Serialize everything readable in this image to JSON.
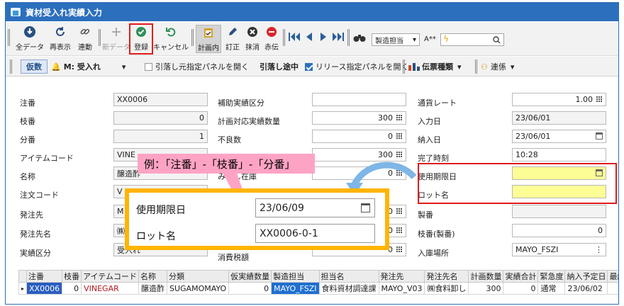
{
  "window": {
    "title": "資材受入れ実績入力"
  },
  "toolbar": {
    "all_data": "全データ",
    "redisplay": "再表示",
    "link": "連動",
    "new_data": "新データ",
    "register": "登録",
    "cancel": "キャンセル",
    "in_plan": "計画内",
    "correct": "訂正",
    "delete": "抹消",
    "red_slip": "赤伝",
    "field_select": "製造担当",
    "font_label": "A**"
  },
  "toolbar2": {
    "kari": "仮数",
    "mode": "M: 受入れ",
    "deduct_panel": "引落し元指定パネルを開く",
    "deduct_status": "引落し途中",
    "release_panel": "リリース指定パネルを開く",
    "slip_type": "伝票種類",
    "link": "連係"
  },
  "form": {
    "col1": [
      {
        "label": "注番",
        "value": "XX0006"
      },
      {
        "label": "枝番",
        "value": "0"
      },
      {
        "label": "分番",
        "value": "1"
      },
      {
        "label": "アイテムコード",
        "value": "VINE"
      },
      {
        "label": "名称",
        "value": "醸造酢"
      },
      {
        "label": "注文コード",
        "value": "V"
      },
      {
        "label": "発注先",
        "value": "M"
      },
      {
        "label": "発注先名",
        "value": "㈱"
      },
      {
        "label": "実績区分",
        "value": "受入れ"
      }
    ],
    "col2": [
      {
        "label": "補助実績区分",
        "value": ""
      },
      {
        "label": "計画対応実績数量",
        "value": "300"
      },
      {
        "label": "不良数",
        "value": "0"
      },
      {
        "label": "",
        "value": "300"
      },
      {
        "label": "みなし在庫",
        "value": "0"
      },
      {
        "label": "",
        "value": "0.0"
      },
      {
        "label": "",
        "value": "0.0"
      },
      {
        "label": "",
        "value": "0"
      },
      {
        "label": "消費税額",
        "value": ""
      }
    ],
    "col3": [
      {
        "label": "通貨レート",
        "value": "1.00"
      },
      {
        "label": "入力日",
        "value": "23/06/01"
      },
      {
        "label": "納入日",
        "value": "23/06/01"
      },
      {
        "label": "完了時刻",
        "value": "10:28"
      },
      {
        "label": "使用期限日",
        "value": ""
      },
      {
        "label": "ロット名",
        "value": ""
      },
      {
        "label": "製番",
        "value": ""
      },
      {
        "label": "枝番(製番)",
        "value": "0"
      },
      {
        "label": "入庫場所",
        "value": "MAYO_FSZI"
      }
    ]
  },
  "callout": {
    "text": "例：「注番」-「枝番」-「分番」"
  },
  "zoom": {
    "expiry_label": "使用期限日",
    "expiry_value": "23/06/09",
    "lot_label": "ロット名",
    "lot_value": "XX0006-0-1"
  },
  "grid": {
    "headers": [
      "注番",
      "枝番",
      "アイテムコード",
      "名称",
      "分類",
      "仮実績数量",
      "製造担当",
      "担当名",
      "発注先",
      "発注先名",
      "計画数量",
      "実績合計",
      "緊急度",
      "納入予定日",
      "最終"
    ],
    "row": [
      "XX0006",
      "0",
      "VINEGAR",
      "醸造酢",
      "SUGAMOMAYO",
      "0",
      "MAYO_FSZI",
      "食料資材調達課",
      "MAYO_V03",
      "㈱食料卸し",
      "300",
      "0",
      "通常",
      "23/06/02",
      ""
    ]
  },
  "colors": {
    "titlebar": "#2c6fbd",
    "highlight": "#fdfd96",
    "callout": "#ffa3c5",
    "zoom_border": "#ffb400",
    "selection": "#2a5ec0"
  }
}
